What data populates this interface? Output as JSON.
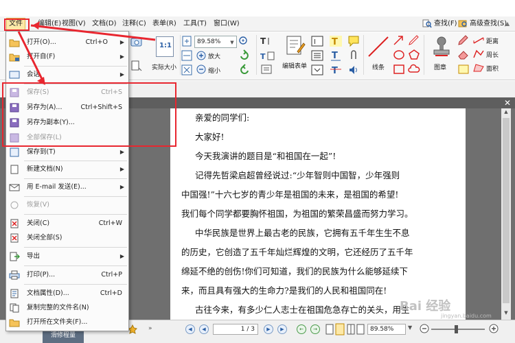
{
  "menubar": {
    "items": [
      "文件",
      "编辑(E)",
      "视图(V)",
      "文档(D)",
      "注释(C)",
      "表单(R)",
      "工具(T)",
      "窗口(W)"
    ],
    "find": "查找(F)",
    "advanced_find": "高级查找(S)"
  },
  "ribbon": {
    "actual_size": "实际大小",
    "zoom_value": "89.58%",
    "zoom_in": "放大",
    "zoom_out": "缩小",
    "edit_form": "编辑表单",
    "line": "线条",
    "stamp": "图章",
    "distance": "距离",
    "perimeter": "周长",
    "area": "面积"
  },
  "file_menu": {
    "items": [
      {
        "label": "打开(O)...",
        "shortcut": "Ctrl+O",
        "submenu": true,
        "disabled": false
      },
      {
        "label": "打开自(F)",
        "shortcut": "",
        "submenu": true,
        "disabled": false
      },
      {
        "label": "会话",
        "shortcut": "",
        "submenu": true,
        "disabled": false
      },
      {
        "label": "保存(S)",
        "shortcut": "Ctrl+S",
        "submenu": false,
        "disabled": true
      },
      {
        "label": "另存为(A)...",
        "shortcut": "Ctrl+Shift+S",
        "submenu": false,
        "disabled": false
      },
      {
        "label": "另存为副本(Y)...",
        "shortcut": "",
        "submenu": false,
        "disabled": false
      },
      {
        "label": "全部保存(L)",
        "shortcut": "",
        "submenu": false,
        "disabled": true
      },
      {
        "label": "保存到(T)",
        "shortcut": "",
        "submenu": true,
        "disabled": false
      },
      {
        "label": "新建文档(N)",
        "shortcut": "",
        "submenu": true,
        "disabled": false
      },
      {
        "label": "用 E-mail 发送(E)...",
        "shortcut": "",
        "submenu": true,
        "disabled": false
      },
      {
        "label": "恢复(V)",
        "shortcut": "",
        "submenu": false,
        "disabled": true
      },
      {
        "label": "关闭(C)",
        "shortcut": "Ctrl+W",
        "submenu": false,
        "disabled": false
      },
      {
        "label": "关闭全部(S)",
        "shortcut": "",
        "submenu": false,
        "disabled": false
      },
      {
        "label": "导出",
        "shortcut": "",
        "submenu": true,
        "disabled": false
      },
      {
        "label": "打印(P)...",
        "shortcut": "Ctrl+P",
        "submenu": false,
        "disabled": false
      },
      {
        "label": "文档属性(D)...",
        "shortcut": "Ctrl+D",
        "submenu": false,
        "disabled": false
      },
      {
        "label": "复制完整的文件名(N)",
        "shortcut": "",
        "submenu": false,
        "disabled": false
      },
      {
        "label": "打开所在文件夹(F)...",
        "shortcut": "",
        "submenu": false,
        "disabled": false
      }
    ]
  },
  "document": {
    "paragraphs": [
      "亲爱的同学们:",
      "大家好!",
      "今天我演讲的题目是“和祖国在一起”!",
      "记得先哲梁启超曾经说过:“少年智则中国智，少年强则",
      "中国强!”十六七岁的青少年是祖国的未来，是祖国的希望!",
      "我们每个同学都要胸怀祖国，为祖国的繁荣昌盛而努力学习。",
      "中华民族是世界上最古老的民族，它拥有五千年生生不息",
      "的历史，它创造了五千年灿烂辉煌的文明，它还经历了五千年",
      "绵延不绝的创伤!你们可知道，我们的民族为什么能够延续下",
      "来，而且具有强大的生命力?是我们的人民和祖国同在!",
      "古往今来，有多少仁人志士在祖国危急存亡的关头，用生"
    ]
  },
  "statusbar": {
    "page_value": "1 / 3",
    "zoom_value": "89.58%",
    "bottom_tab": "滑修程量"
  },
  "watermark": {
    "text": "Bai 经验",
    "url": "jingyan.baidu.com"
  },
  "colors": {
    "annotation_red": "#e8262f",
    "menu_active_bg": "#fde9a8",
    "doc_background": "#6f6f6f"
  }
}
